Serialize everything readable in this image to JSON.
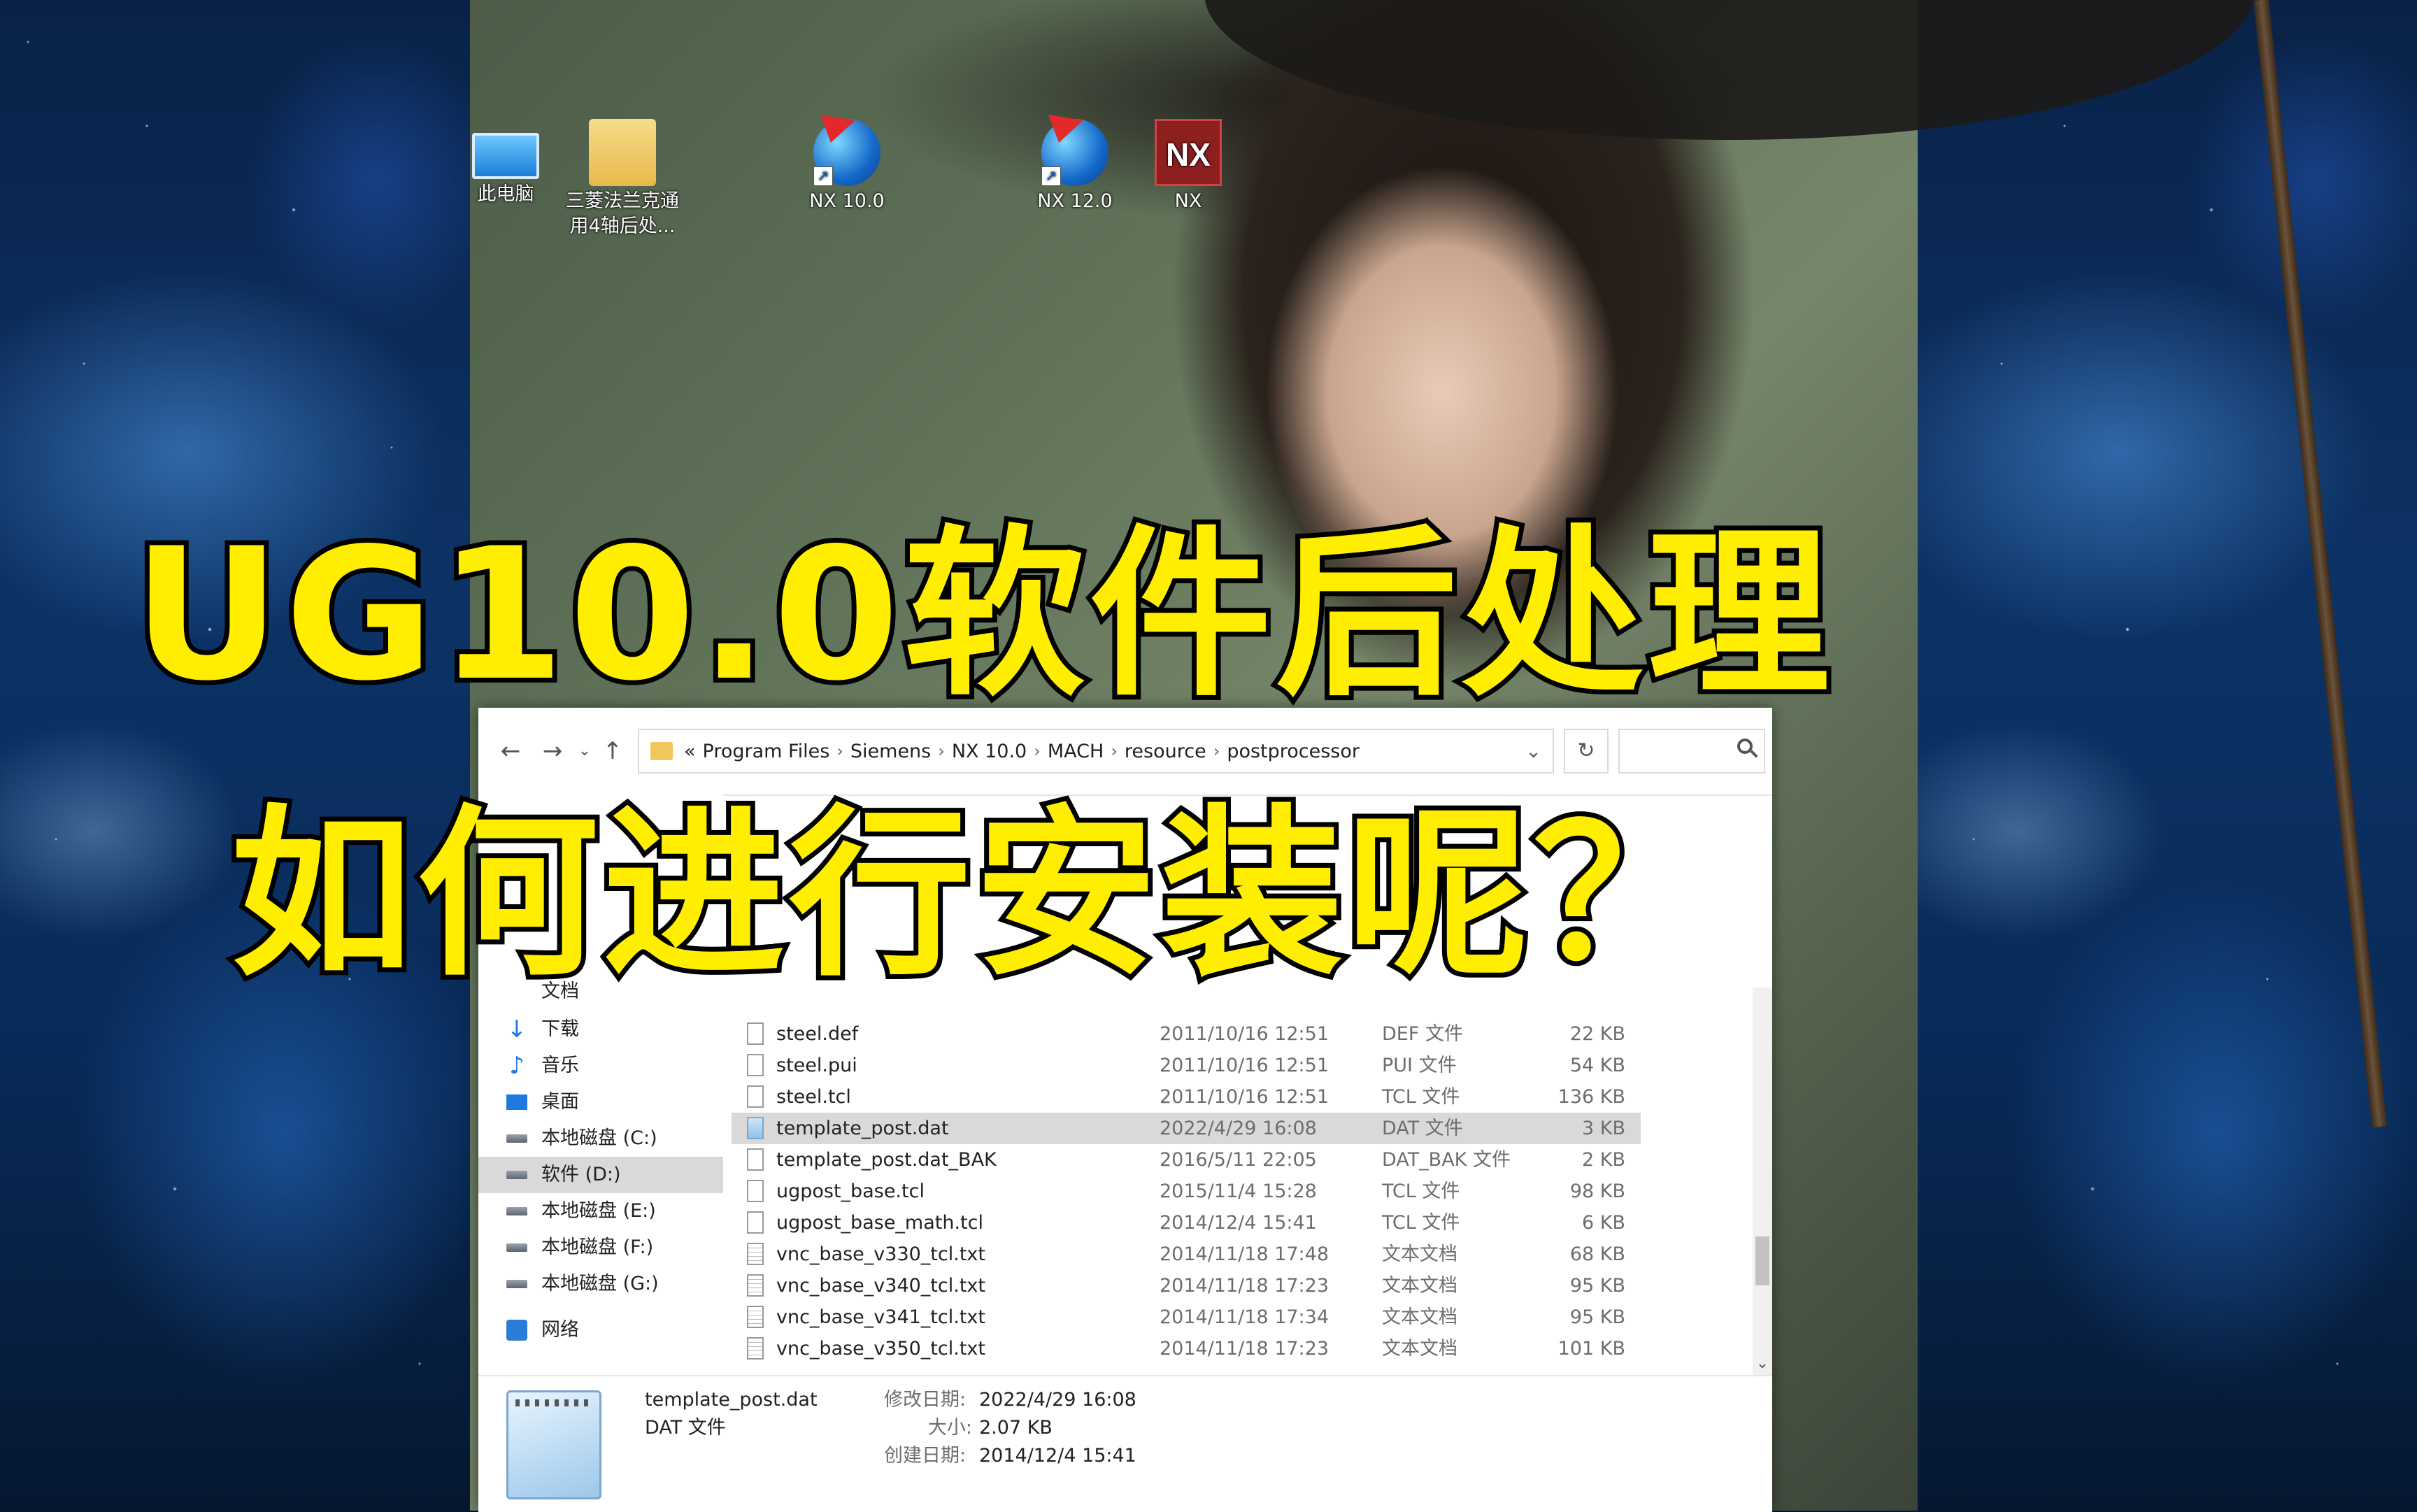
{
  "desktop": {
    "icons": [
      {
        "label": "此电脑",
        "icon": "computer-icon"
      },
      {
        "label": "三菱法兰克通用4轴后处...",
        "icon": "folder-icon"
      },
      {
        "label": "NX 10.0",
        "icon": "nx-globe-icon"
      },
      {
        "label": "NX 12.0",
        "icon": "nx-globe-icon"
      },
      {
        "label": "NX",
        "icon": "nx-logo-icon",
        "logo_text": "NX"
      }
    ]
  },
  "explorer": {
    "path": [
      "Program Files",
      "Siemens",
      "NX 10.0",
      "MACH",
      "resource",
      "postprocessor"
    ],
    "path_prefix": "«",
    "nav": [
      {
        "label": "文档",
        "icon": "documents-icon"
      },
      {
        "label": "下载",
        "icon": "download-icon"
      },
      {
        "label": "音乐",
        "icon": "music-icon"
      },
      {
        "label": "桌面",
        "icon": "desktop-icon"
      },
      {
        "label": "本地磁盘 (C:)",
        "icon": "drive-icon"
      },
      {
        "label": "软件 (D:)",
        "icon": "drive-icon",
        "selected": true
      },
      {
        "label": "本地磁盘 (E:)",
        "icon": "drive-icon"
      },
      {
        "label": "本地磁盘 (F:)",
        "icon": "drive-icon"
      },
      {
        "label": "本地磁盘 (G:)",
        "icon": "drive-icon"
      },
      {
        "label": "网络",
        "icon": "network-icon"
      }
    ],
    "files": [
      {
        "name": "steel.def",
        "date": "2011/10/16 12:51",
        "type": "DEF 文件",
        "size": "22 KB",
        "icon": "file"
      },
      {
        "name": "steel.pui",
        "date": "2011/10/16 12:51",
        "type": "PUI 文件",
        "size": "54 KB",
        "icon": "file"
      },
      {
        "name": "steel.tcl",
        "date": "2011/10/16 12:51",
        "type": "TCL 文件",
        "size": "136 KB",
        "icon": "file"
      },
      {
        "name": "template_post.dat",
        "date": "2022/4/29 16:08",
        "type": "DAT 文件",
        "size": "3 KB",
        "icon": "dat",
        "selected": true
      },
      {
        "name": "template_post.dat_BAK",
        "date": "2016/5/11 22:05",
        "type": "DAT_BAK 文件",
        "size": "2 KB",
        "icon": "file"
      },
      {
        "name": "ugpost_base.tcl",
        "date": "2015/11/4 15:28",
        "type": "TCL 文件",
        "size": "98 KB",
        "icon": "file"
      },
      {
        "name": "ugpost_base_math.tcl",
        "date": "2014/12/4 15:41",
        "type": "TCL 文件",
        "size": "6 KB",
        "icon": "file"
      },
      {
        "name": "vnc_base_v330_tcl.txt",
        "date": "2014/11/18 17:48",
        "type": "文本文档",
        "size": "68 KB",
        "icon": "txt"
      },
      {
        "name": "vnc_base_v340_tcl.txt",
        "date": "2014/11/18 17:23",
        "type": "文本文档",
        "size": "95 KB",
        "icon": "txt"
      },
      {
        "name": "vnc_base_v341_tcl.txt",
        "date": "2014/11/18 17:34",
        "type": "文本文档",
        "size": "95 KB",
        "icon": "txt"
      },
      {
        "name": "vnc_base_v350_tcl.txt",
        "date": "2014/11/18 17:23",
        "type": "文本文档",
        "size": "101 KB",
        "icon": "txt"
      }
    ],
    "details": {
      "filename": "template_post.dat",
      "filetype": "DAT 文件",
      "modified_label": "修改日期:",
      "modified_value": "2022/4/29 16:08",
      "size_label": "大小:",
      "size_value": "2.07 KB",
      "created_label": "创建日期:",
      "created_value": "2014/12/4 15:41"
    }
  },
  "overlay": {
    "line1": "UG10.0软件后处理",
    "line2": "如何进行安装呢？",
    "color": "#ffee00"
  }
}
